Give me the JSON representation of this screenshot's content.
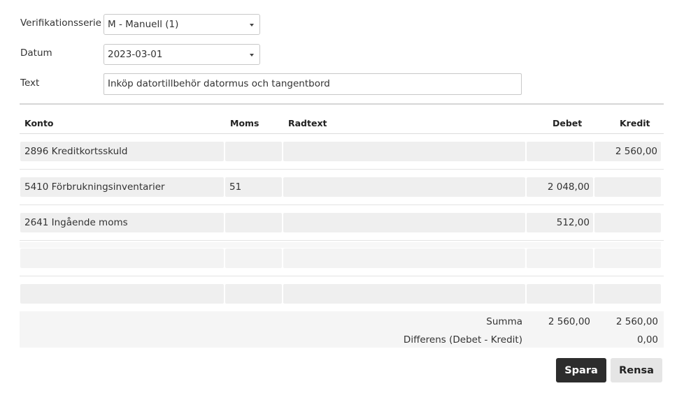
{
  "form": {
    "series": {
      "label": "Verifikationsserie",
      "value": "M - Manuell (1)"
    },
    "date": {
      "label": "Datum",
      "value": "2023-03-01"
    },
    "text": {
      "label": "Text",
      "value": "Inköp datortillbehör datormus och tangentbord"
    }
  },
  "table": {
    "headers": {
      "account": "Konto",
      "vat": "Moms",
      "rowtext": "Radtext",
      "debit": "Debet",
      "credit": "Kredit"
    },
    "rows": [
      {
        "account": "2896 Kreditkortsskuld",
        "vat": "",
        "rowtext": "",
        "debit": "",
        "credit": "2 560,00"
      },
      {
        "account": "5410 Förbrukningsinventarier",
        "vat": "51",
        "rowtext": "",
        "debit": "2 048,00",
        "credit": ""
      },
      {
        "account": "2641 Ingående moms",
        "vat": "",
        "rowtext": "",
        "debit": "512,00",
        "credit": ""
      },
      {
        "account": "",
        "vat": "",
        "rowtext": "",
        "debit": "",
        "credit": ""
      },
      {
        "account": "",
        "vat": "",
        "rowtext": "",
        "debit": "",
        "credit": ""
      }
    ]
  },
  "summary": {
    "sum_label": "Summa",
    "sum_debit": "2 560,00",
    "sum_credit": "2 560,00",
    "diff_label": "Differens (Debet - Kredit)",
    "diff_value": "0,00"
  },
  "buttons": {
    "save": "Spara",
    "clear": "Rensa"
  },
  "icons": {
    "dropdown": "chevron-down-icon"
  }
}
